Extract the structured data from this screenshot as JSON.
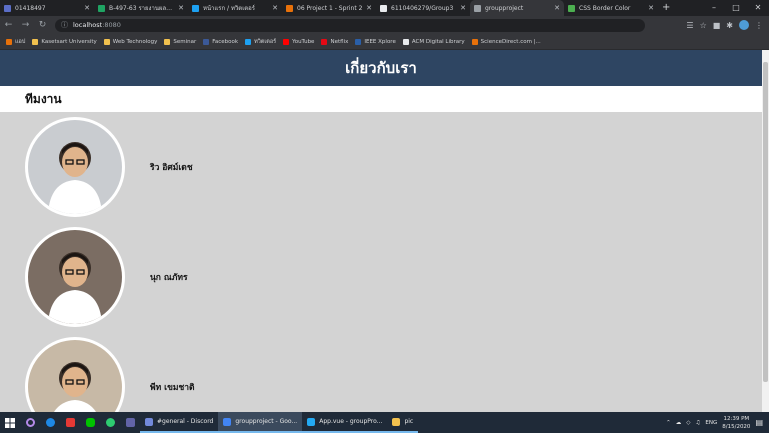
{
  "browser": {
    "tabs": [
      {
        "title": "01418497",
        "color": "#5b6ec7"
      },
      {
        "title": "B-497-63 รายงานผลกลุ่ม",
        "color": "#1fa463"
      },
      {
        "title": "หน้าแรก / ทวิตเตอร์",
        "color": "#1da1f2"
      },
      {
        "title": "06 Project 1 - Sprint 2",
        "color": "#e8710a"
      },
      {
        "title": "6110406279/Group3",
        "color": "#e8eaed"
      },
      {
        "title": "groupproject",
        "color": "#9aa0a6"
      },
      {
        "title": "CSS Border Color",
        "color": "#4caf50"
      }
    ],
    "new_tab_symbol": "+",
    "address": {
      "host": "localhost",
      "port": ":8080"
    },
    "bookmarks": [
      {
        "label": "แอป",
        "color": "#e8710a"
      },
      {
        "label": "Kasetsart University",
        "color": "#f2c14e"
      },
      {
        "label": "Web Technology",
        "color": "#f2c14e"
      },
      {
        "label": "Seminar",
        "color": "#f2c14e"
      },
      {
        "label": "Facebook",
        "color": "#3b5998"
      },
      {
        "label": "ทวิตเตอร์",
        "color": "#1da1f2"
      },
      {
        "label": "YouTube",
        "color": "#ff0000"
      },
      {
        "label": "Netflix",
        "color": "#e50914"
      },
      {
        "label": "IEEE Xplore",
        "color": "#2a5fa8"
      },
      {
        "label": "ACM Digital Library",
        "color": "#e8eaed"
      },
      {
        "label": "ScienceDirect.com |...",
        "color": "#e8710a"
      }
    ]
  },
  "page": {
    "header_title": "เกี่ยวกับเรา",
    "section_title": "ทีมงาน",
    "members": [
      {
        "name": "ริว อิศม์เดช",
        "photo_bg": "#c9ccd0"
      },
      {
        "name": "นุก ณภัทร",
        "photo_bg": "#7b6d63"
      },
      {
        "name": "พีท เขมชาติ",
        "photo_bg": "#c7b9a6"
      }
    ]
  },
  "taskbar": {
    "apps": [
      {
        "label": "#general - Discord",
        "color": "#7289da"
      },
      {
        "label": "groupproject - Goo...",
        "color": "#4285f4"
      },
      {
        "label": "App.vue - groupPro...",
        "color": "#23a9f2"
      },
      {
        "label": "pic",
        "color": "#f2c14e"
      }
    ],
    "lang": "ENG",
    "time": "12:39 PM",
    "date": "8/15/2020"
  }
}
